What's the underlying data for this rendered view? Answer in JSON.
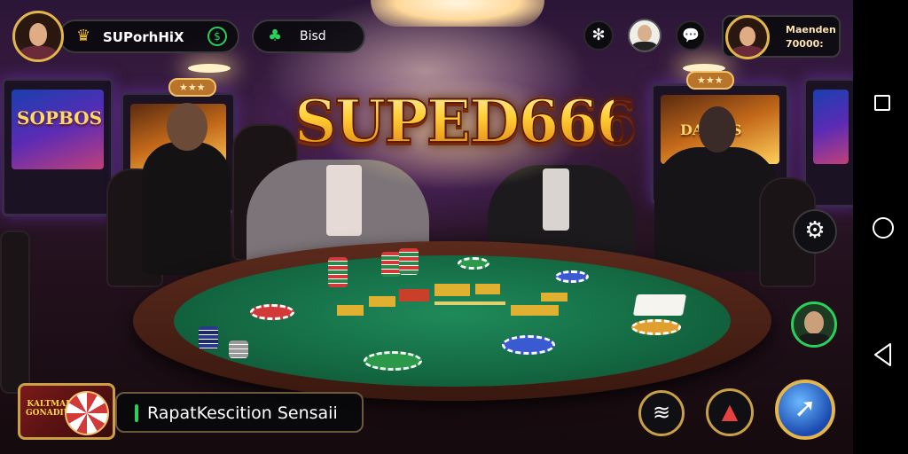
{
  "hud": {
    "player_name": "SUPorhHiX",
    "balance_label": "Bisd",
    "profile_card_line1": "Maenden",
    "profile_card_line2": "70000:"
  },
  "logo": {
    "text": "SUPED666"
  },
  "scene": {
    "slot_left_text": "SOPBOS",
    "slot_right_text": "DAMOS"
  },
  "bottom": {
    "promo_text": "KALTMAR GONADIUN",
    "ticker_text": "RapatKescition Sensaii"
  },
  "icons": {
    "top": [
      "user-avatar-icon",
      "crown-icon",
      "cash-icon",
      "plant-icon",
      "settings-icon",
      "friend-avatar-icon",
      "chat-icon"
    ],
    "side": [
      "settings-gear-icon",
      "player-avatar-icon"
    ],
    "bottom": [
      "sound-icon",
      "gift-icon",
      "sword-icon"
    ],
    "navbar": [
      "recents-icon",
      "home-icon",
      "back-icon"
    ]
  },
  "colors": {
    "accent_gold": "#e3b54a",
    "accent_green": "#2ad05a",
    "felt_green": "#146a43"
  }
}
